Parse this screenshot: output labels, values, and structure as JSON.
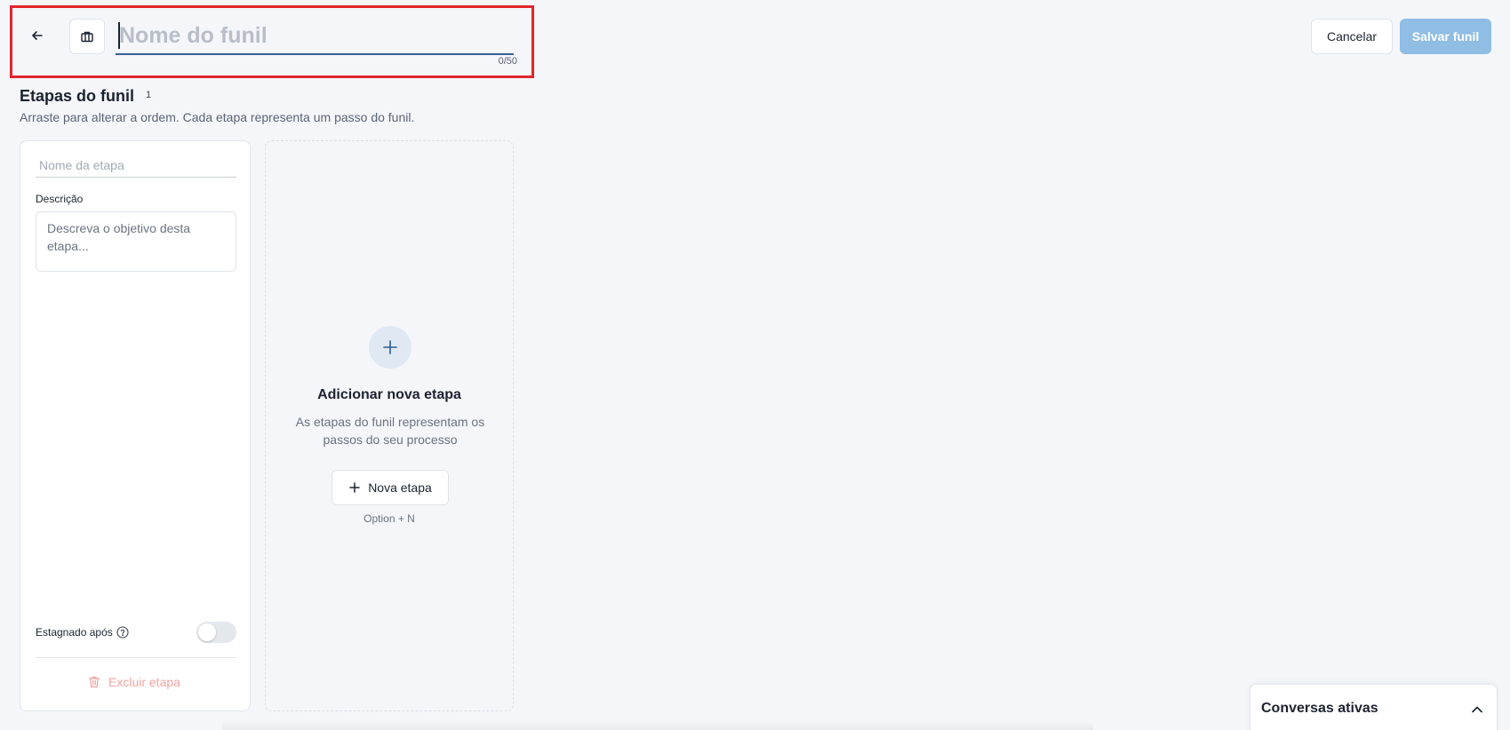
{
  "header": {
    "title_placeholder": "Nome do funil",
    "title_value": "",
    "char_counter": "0/50",
    "cancel_label": "Cancelar",
    "save_label": "Salvar funil"
  },
  "stages": {
    "title": "Etapas do funil",
    "count": "1",
    "subtitle": "Arraste para alterar a ordem. Cada etapa representa um passo do funil."
  },
  "stage_card": {
    "name_placeholder": "Nome da etapa",
    "description_label": "Descrição",
    "description_placeholder": "Descreva o objetivo desta etapa...",
    "stagnation_label": "Estagnado após",
    "stagnation_enabled": false,
    "delete_label": "Excluir etapa"
  },
  "add_stage": {
    "title": "Adicionar nova etapa",
    "description": "As etapas do funil representam os passos do seu processo",
    "button_label": "Nova etapa",
    "shortcut": "Option + N"
  },
  "conversations": {
    "title": "Conversas ativas"
  },
  "icons": {
    "back": "arrow-left-icon",
    "funnel": "briefcase-icon",
    "help": "help-circle-icon",
    "toggle": "toggle-off",
    "delete": "trash-icon",
    "add": "plus-icon",
    "expand": "chevron-up-icon"
  },
  "colors": {
    "accent": "#3b5f95",
    "save_disabled": "#8fbde3",
    "danger_muted": "#f2a3a3",
    "background": "#f4f6fa",
    "highlight": "#e3262b"
  }
}
